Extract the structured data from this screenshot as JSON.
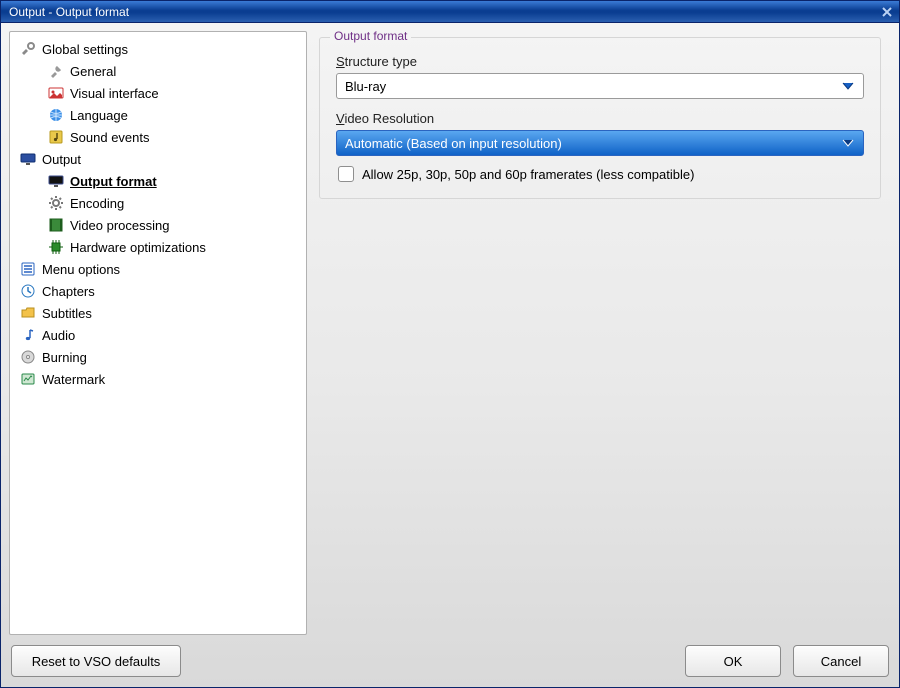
{
  "window": {
    "title": "Output - Output format"
  },
  "tree": {
    "items": [
      {
        "id": "global",
        "icon": "tools-icon",
        "label": "Global settings",
        "children": [
          {
            "id": "general",
            "icon": "tool-icon",
            "label": "General"
          },
          {
            "id": "visual",
            "icon": "image-icon",
            "label": "Visual interface"
          },
          {
            "id": "language",
            "icon": "globe-icon",
            "label": "Language"
          },
          {
            "id": "sound",
            "icon": "music-icon",
            "label": "Sound events"
          }
        ]
      },
      {
        "id": "output",
        "icon": "monitor-icon",
        "label": "Output",
        "children": [
          {
            "id": "output-format",
            "icon": "monitor2-icon",
            "label": "Output format",
            "selected": true
          },
          {
            "id": "encoding",
            "icon": "gear-icon",
            "label": "Encoding"
          },
          {
            "id": "videoproc",
            "icon": "film-icon",
            "label": "Video processing"
          },
          {
            "id": "hwopt",
            "icon": "chip-icon",
            "label": "Hardware optimizations"
          }
        ]
      },
      {
        "id": "menuopt",
        "icon": "menu-icon",
        "label": "Menu options"
      },
      {
        "id": "chapters",
        "icon": "clock-icon",
        "label": "Chapters"
      },
      {
        "id": "subtitles",
        "icon": "folder-icon",
        "label": "Subtitles"
      },
      {
        "id": "audio",
        "icon": "note-icon",
        "label": "Audio"
      },
      {
        "id": "burning",
        "icon": "disc-icon",
        "label": "Burning"
      },
      {
        "id": "watermark",
        "icon": "watermark-icon",
        "label": "Watermark"
      }
    ]
  },
  "panel": {
    "group_title": "Output format",
    "structure": {
      "label_pre": "",
      "mnemonic": "S",
      "label_post": "tructure type",
      "value": "Blu-ray"
    },
    "resolution": {
      "label_pre": "",
      "mnemonic": "V",
      "label_post": "ideo Resolution",
      "value": "Automatic (Based on input resolution)"
    },
    "framerate_checkbox": {
      "checked": false,
      "label": "Allow 25p, 30p, 50p and 60p framerates (less compatible)"
    }
  },
  "buttons": {
    "reset": "Reset to VSO defaults",
    "ok": "OK",
    "cancel": "Cancel"
  }
}
